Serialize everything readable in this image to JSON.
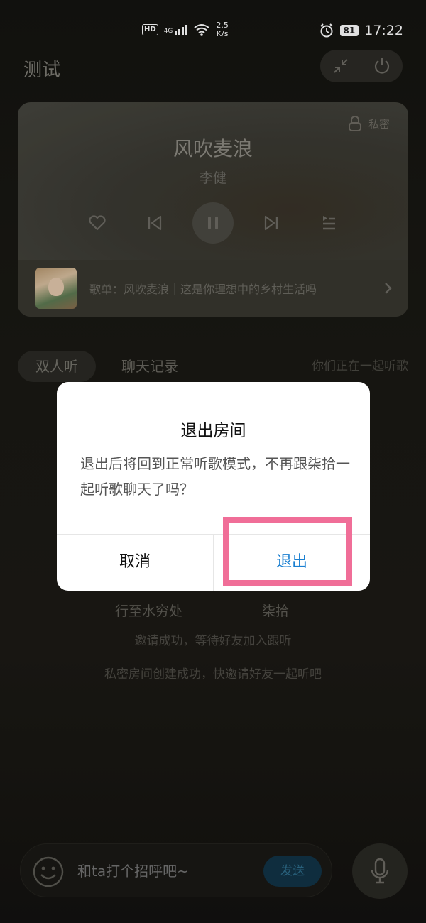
{
  "status_bar": {
    "hd": "HD",
    "network": "4G",
    "speed_value": "2.5",
    "speed_unit": "K/s",
    "battery": "81",
    "time": "17:22"
  },
  "header": {
    "title": "测试"
  },
  "player": {
    "private_label": "私密",
    "song_title": "风吹麦浪",
    "artist": "李健",
    "playlist_text": "歌单：风吹麦浪｜这是你理想中的乡村生活吗"
  },
  "tabs": {
    "duo": "双人听",
    "chat": "聊天记录",
    "hint": "你们正在一起听歌"
  },
  "background": {
    "name_left": "行至水穷处",
    "name_right": "柒拾",
    "msg_invite": "邀请成功，等待好友加入跟听",
    "msg_created": "私密房间创建成功，快邀请好友一起听吧"
  },
  "dialog": {
    "title": "退出房间",
    "body": "退出后将回到正常听歌模式，不再跟柒拾一起听歌聊天了吗？",
    "cancel": "取消",
    "confirm": "退出"
  },
  "composer": {
    "placeholder": "和ta打个招呼吧~",
    "send": "发送"
  },
  "colors": {
    "accent": "#1a7fd1",
    "highlight": "#f06e98"
  }
}
